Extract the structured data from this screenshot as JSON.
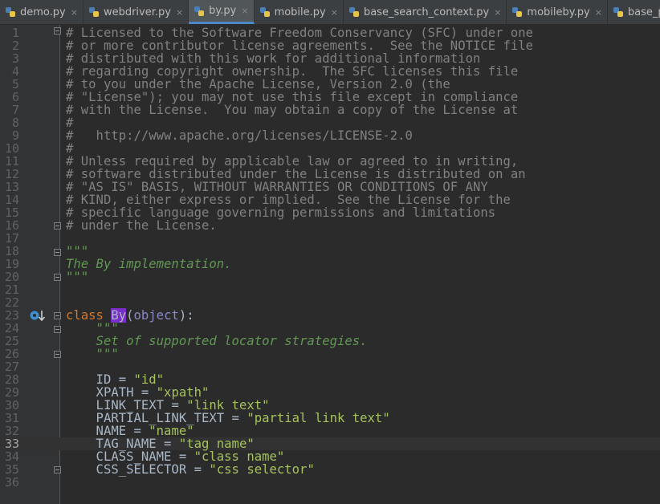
{
  "tabs": [
    {
      "label": "demo.py"
    },
    {
      "label": "webdriver.py"
    },
    {
      "label": "by.py"
    },
    {
      "label": "mobile.py"
    },
    {
      "label": "base_search_context.py"
    },
    {
      "label": "mobileby.py"
    },
    {
      "label": "base_page.py"
    }
  ],
  "close_glyph": "×",
  "lines": [
    {
      "n": "1",
      "t": "# Licensed to the Software Freedom Conservancy (SFC) under one"
    },
    {
      "n": "2",
      "t": "# or more contributor license agreements.  See the NOTICE file"
    },
    {
      "n": "3",
      "t": "# distributed with this work for additional information"
    },
    {
      "n": "4",
      "t": "# regarding copyright ownership.  The SFC licenses this file"
    },
    {
      "n": "5",
      "t": "# to you under the Apache License, Version 2.0 (the"
    },
    {
      "n": "6",
      "t": "# \"License\"); you may not use this file except in compliance"
    },
    {
      "n": "7",
      "t": "# with the License.  You may obtain a copy of the License at"
    },
    {
      "n": "8",
      "t": "#"
    },
    {
      "n": "9",
      "t": "#   http://www.apache.org/licenses/LICENSE-2.0"
    },
    {
      "n": "10",
      "t": "#"
    },
    {
      "n": "11",
      "t": "# Unless required by applicable law or agreed to in writing,"
    },
    {
      "n": "12",
      "t": "# software distributed under the License is distributed on an"
    },
    {
      "n": "13",
      "t": "# \"AS IS\" BASIS, WITHOUT WARRANTIES OR CONDITIONS OF ANY"
    },
    {
      "n": "14",
      "t": "# KIND, either express or implied.  See the License for the"
    },
    {
      "n": "15",
      "t": "# specific language governing permissions and limitations"
    },
    {
      "n": "16",
      "t": "# under the License."
    },
    {
      "n": "17",
      "t": ""
    },
    {
      "n": "18",
      "t": "\"\"\""
    },
    {
      "n": "19",
      "t": "The By implementation."
    },
    {
      "n": "20",
      "t": "\"\"\""
    },
    {
      "n": "21",
      "t": ""
    },
    {
      "n": "22",
      "t": ""
    },
    {
      "n": "23",
      "kw": "class",
      "cls": "By",
      "builtin": "object",
      "tail": "):"
    },
    {
      "n": "24",
      "t": "    \"\"\""
    },
    {
      "n": "25",
      "t": "    Set of supported locator strategies."
    },
    {
      "n": "26",
      "t": "    \"\"\""
    },
    {
      "n": "27",
      "t": ""
    },
    {
      "n": "28",
      "name": "    ID",
      "val": "\"id\""
    },
    {
      "n": "29",
      "name": "    XPATH",
      "val": "\"xpath\""
    },
    {
      "n": "30",
      "name": "    LINK_TEXT",
      "val": "\"link text\""
    },
    {
      "n": "31",
      "name": "    PARTIAL_LINK_TEXT",
      "val": "\"partial link text\""
    },
    {
      "n": "32",
      "name": "    NAME",
      "val": "\"name\""
    },
    {
      "n": "33",
      "name": "    TAG_NAME",
      "val": "\"tag name\""
    },
    {
      "n": "34",
      "name": "    CLASS_NAME",
      "val": "\"class name\""
    },
    {
      "n": "35",
      "name": "    CSS_SELECTOR",
      "val": "\"css selector\""
    },
    {
      "n": "36",
      "t": ""
    }
  ],
  "eq": " = ",
  "colors": {
    "background": "#2b2b2b",
    "comment": "#808080",
    "docstring": "#629755",
    "keyword": "#cc7832",
    "string": "#a5c25c",
    "highlight": "#7a2ec7"
  }
}
